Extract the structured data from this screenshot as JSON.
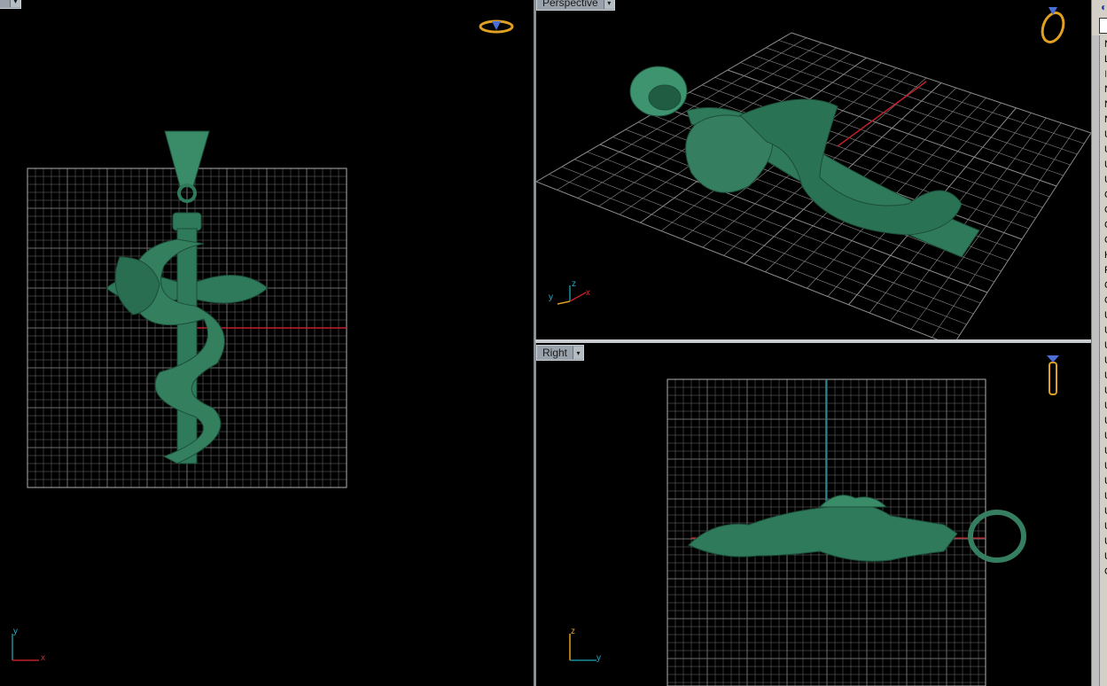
{
  "viewports": {
    "top": {
      "label": "",
      "axes": {
        "a": "y",
        "b": "x"
      },
      "nav_icon": "ring-top-view-icon"
    },
    "perspective": {
      "label": "Perspective",
      "axes": {
        "a": "z",
        "b": "y",
        "c": "x"
      },
      "nav_icon": "ring-perspective-icon"
    },
    "right": {
      "label": "Right",
      "axes": {
        "a": "z",
        "b": "y"
      },
      "nav_icon": "ring-side-view-icon"
    }
  },
  "side_panel": {
    "letters": [
      "N",
      "L",
      "I",
      "N",
      "N",
      "N",
      "U",
      "U",
      "U",
      "U",
      "C",
      "C",
      "C",
      "C",
      "H",
      "F",
      "C",
      "C",
      "U",
      "U",
      "U",
      "U",
      "U",
      "U",
      "U",
      "U",
      "U",
      "U",
      "U",
      "U",
      "U",
      "U",
      "U",
      "U",
      "U",
      "C"
    ]
  },
  "colors": {
    "background": "#000000",
    "grid": "#7a7a7a",
    "model": "#2e7a5a",
    "x_axis": "#c0202a",
    "z_axis": "#1b8c9a",
    "icon": "#e0a020"
  }
}
